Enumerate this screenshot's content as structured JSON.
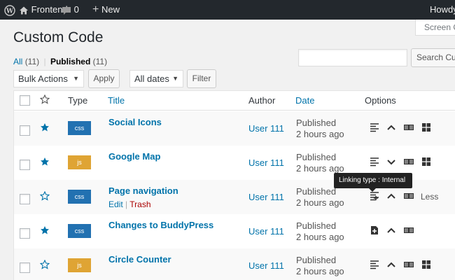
{
  "adminbar": {
    "site_name": "Frontend",
    "comments_count": "0",
    "new_label": "New",
    "howdy": "Howdy"
  },
  "screen_options": "Screen Options",
  "page_title": "Custom Code",
  "filters": {
    "all_label": "All",
    "all_count": "(11)",
    "separator": "|",
    "published_label": "Published",
    "published_count": "(11)"
  },
  "search": {
    "button_label": "Search Custom Code",
    "value": ""
  },
  "bulk": {
    "bulk_value": "Bulk Actions",
    "apply_label": "Apply",
    "dates_value": "All dates",
    "filter_label": "Filter"
  },
  "columns": {
    "type": "Type",
    "title": "Title",
    "author": "Author",
    "date": "Date",
    "options": "Options"
  },
  "rows": [
    {
      "starred": true,
      "type": "css",
      "title": "Social Icons",
      "author": "User 111",
      "status": "Published",
      "when": "2 hours ago"
    },
    {
      "starred": true,
      "type": "js",
      "title": "Google Map",
      "author": "User 111",
      "status": "Published",
      "when": "2 hours ago"
    },
    {
      "starred": false,
      "type": "css",
      "title": "Page navigation",
      "author": "User 111",
      "status": "Published",
      "when": "2 hours ago",
      "edit": "Edit",
      "sep": "|",
      "trash": "Trash",
      "less": "Less"
    },
    {
      "starred": true,
      "type": "css",
      "title": "Changes to BuddyPress",
      "author": "User 111",
      "status": "Published",
      "when": "2 hours ago"
    },
    {
      "starred": false,
      "type": "js",
      "title": "Circle Counter",
      "author": "User 111",
      "status": "Published",
      "when": "2 hours ago"
    }
  ],
  "tooltip": "Linking type : Internal",
  "colors": {
    "adminbar": "#23282d",
    "link": "#0073aa",
    "css_badge": "#2271b1",
    "js_badge": "#dfa434",
    "trash": "#a00"
  }
}
